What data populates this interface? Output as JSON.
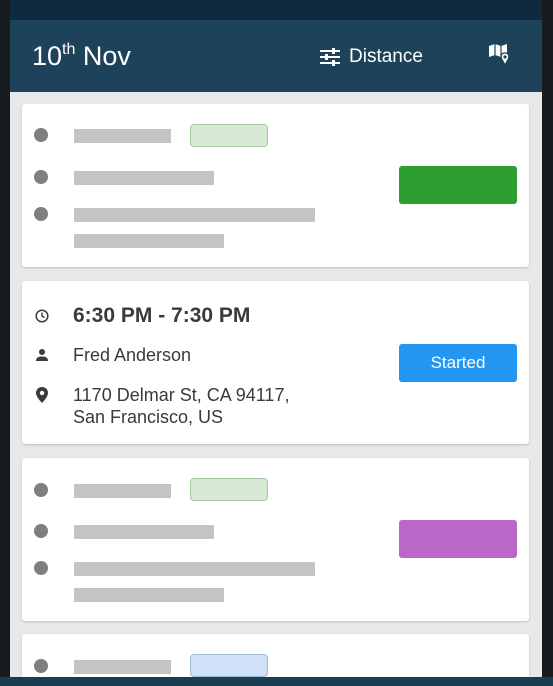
{
  "header": {
    "date_day": "10",
    "date_suffix": "th",
    "date_month": " Nov",
    "sort_label": "Distance",
    "sort_icon": "sliders-icon",
    "map_icon": "map-pin-icon"
  },
  "colors": {
    "header_bg": "#1d4259",
    "statusbar_bg": "#0f2a3c",
    "placeholder_green": "#2e9e32",
    "placeholder_purple": "#b968c7",
    "started_blue": "#2196f3"
  },
  "active_job": {
    "time": "6:30 PM - 7:30 PM",
    "customer": "Fred Anderson",
    "address_line1": "1170 Delmar St, CA 94117,",
    "address_line2": "San Francisco, US",
    "status_label": "Started",
    "icons": [
      "clock-icon",
      "person-icon",
      "location-pin-icon"
    ]
  }
}
